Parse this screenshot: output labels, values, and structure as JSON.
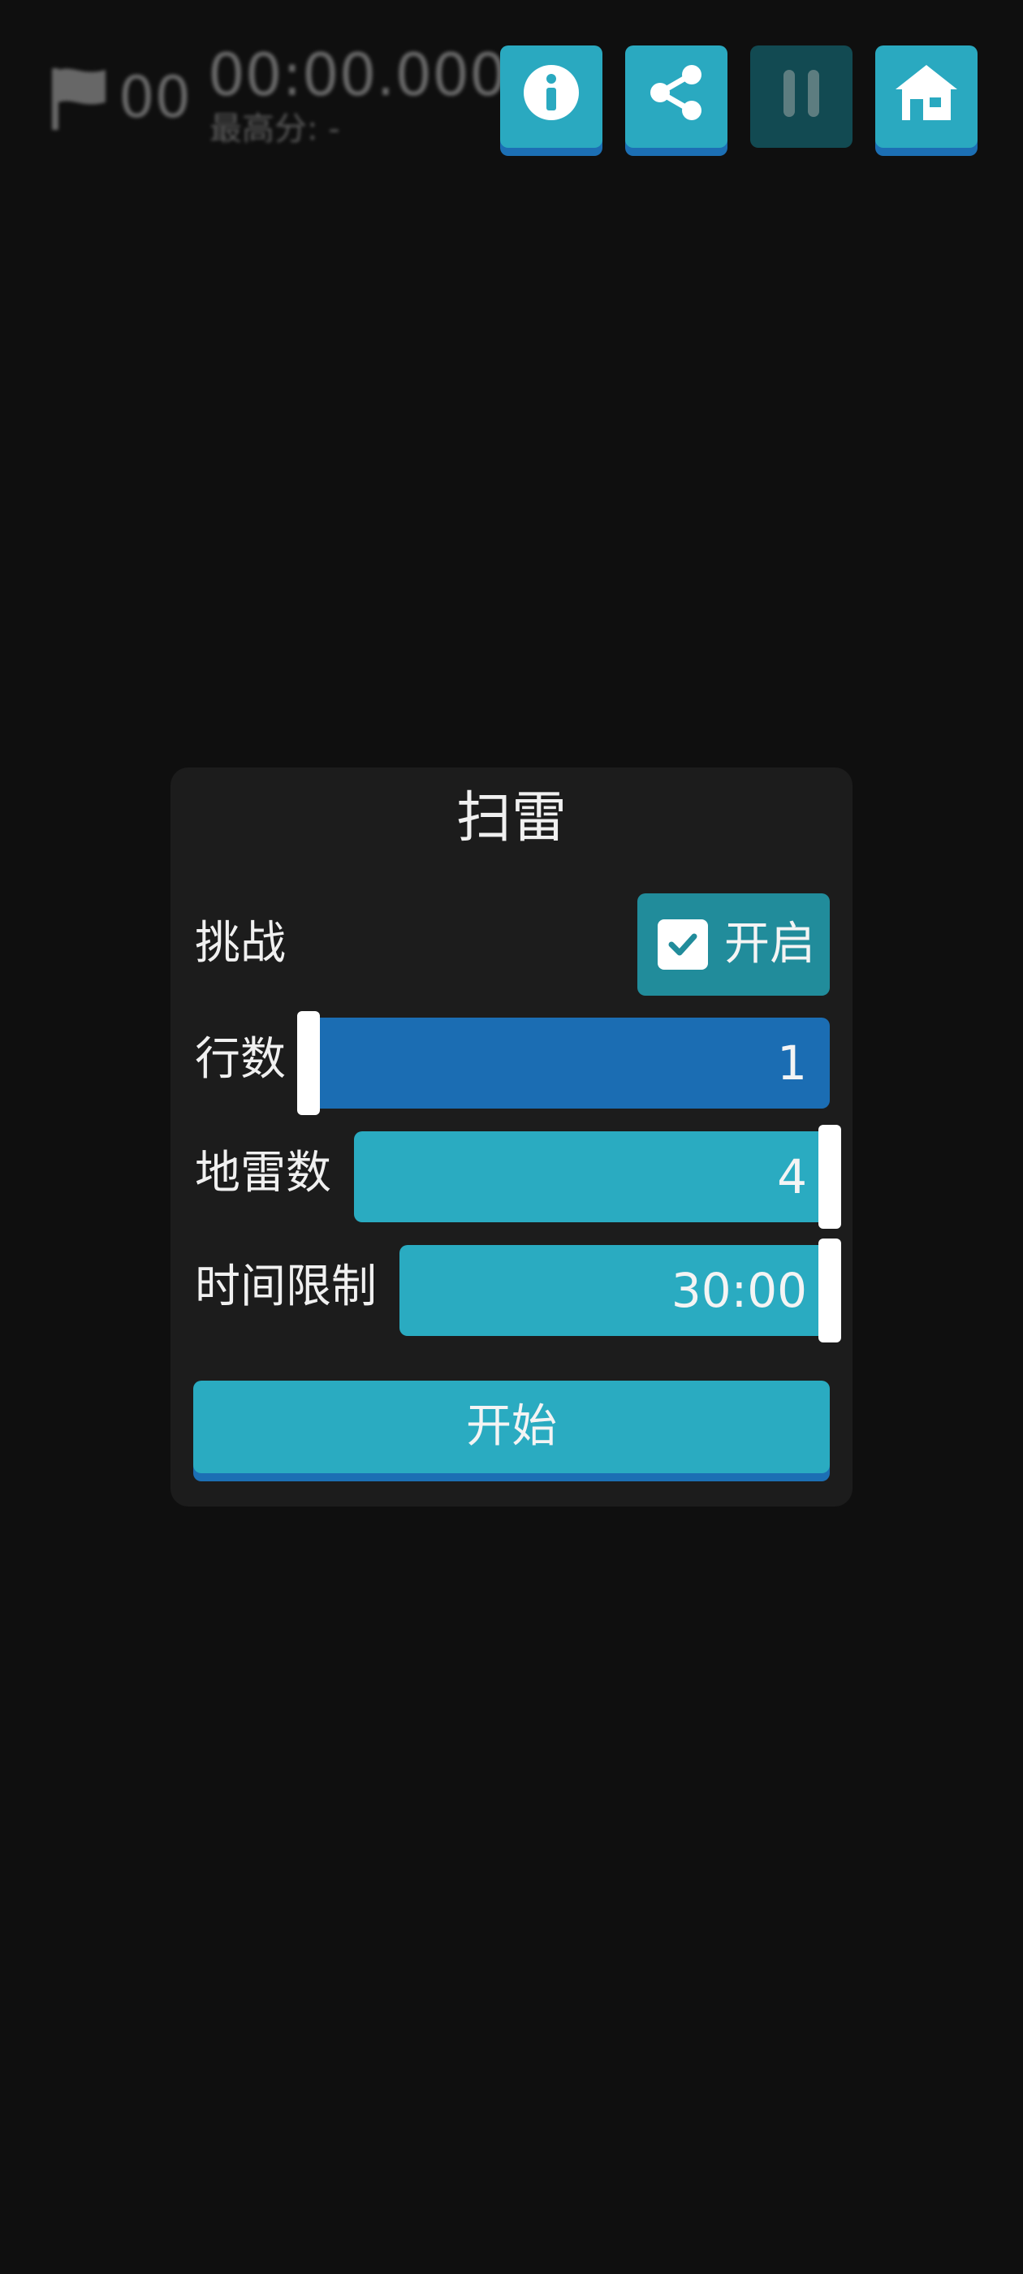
{
  "hud": {
    "flag_count": "00",
    "timer": "00:00.000",
    "best_score": "最高分: -",
    "buttons": [
      {
        "icon": "info-icon"
      },
      {
        "icon": "share-icon"
      },
      {
        "icon": "pause-icon"
      },
      {
        "icon": "home-icon"
      }
    ]
  },
  "dialog": {
    "title": "扫雷",
    "challenge": {
      "label": "挑战",
      "toggle_label": "开启",
      "checked": true
    },
    "rows": {
      "label": "行数",
      "value": "1",
      "fraction": 0.0
    },
    "mines": {
      "label": "地雷数",
      "value": "4",
      "fraction": 1.0
    },
    "time_limit": {
      "label": "时间限制",
      "value": "30:00",
      "fraction": 1.0
    },
    "start_label": "开始"
  },
  "colors": {
    "background": "#0f0f0f",
    "dialog": "#1c1c1c",
    "accent": "#2aabc1",
    "accent_active": "#1b6db3",
    "toggle": "#218c9b",
    "button_shadow": "#1c6fb4"
  }
}
